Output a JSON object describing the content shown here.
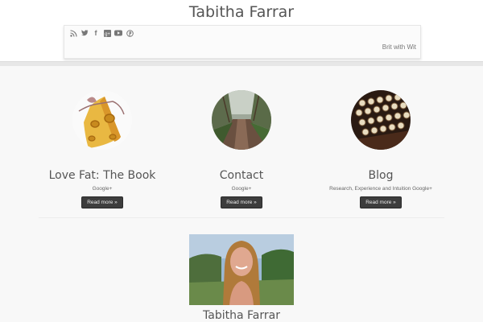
{
  "header": {
    "site_title": "Tabitha Farrar",
    "tagline": "Brit with Wit"
  },
  "social": [
    {
      "icon": "rss-icon",
      "glyph": "◎"
    },
    {
      "icon": "twitter-icon",
      "glyph": "t"
    },
    {
      "icon": "facebook-icon",
      "glyph": "f"
    },
    {
      "icon": "google-plus-icon",
      "glyph": "g+"
    },
    {
      "icon": "youtube-icon",
      "glyph": "▶"
    },
    {
      "icon": "pinterest-icon",
      "glyph": "P"
    }
  ],
  "columns": [
    {
      "title": "Love Fat: The Book",
      "desc": "Google+",
      "button": "Read more »"
    },
    {
      "title": "Contact",
      "desc": "Google+",
      "button": "Read more »"
    },
    {
      "title": "Blog",
      "desc": "Research, Experience and Intuition Google+",
      "button": "Read more »"
    }
  ],
  "profile": {
    "name": "Tabitha Farrar"
  }
}
